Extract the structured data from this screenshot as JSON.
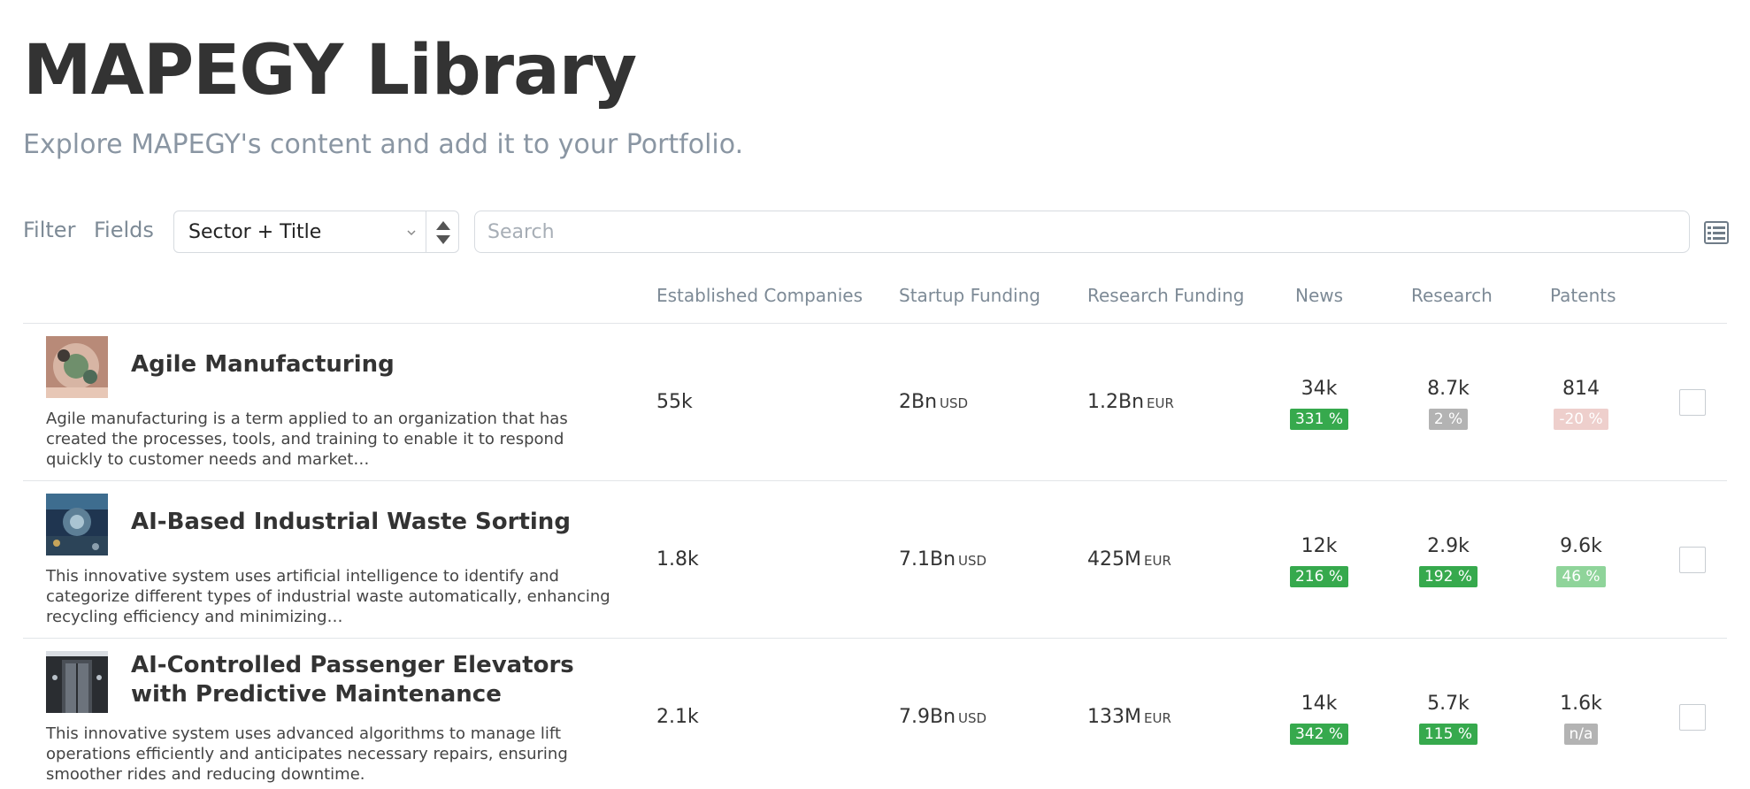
{
  "header": {
    "title": "MAPEGY Library",
    "subtitle": "Explore MAPEGY's content and add it to your Portfolio."
  },
  "toolbar": {
    "filter_label": "Filter",
    "fields_label": "Fields",
    "sort_select_value": "Sector + Title",
    "search_placeholder": "Search",
    "view_toggle_icon": "table-list-icon"
  },
  "table": {
    "columns": [
      "Established Companies",
      "Startup Funding",
      "Research Funding",
      "News",
      "Research",
      "Patents"
    ],
    "rows": [
      {
        "title": "Agile Manufacturing",
        "description": "Agile manufacturing is a term applied to an organization that has created the processes, tools, and training to enable it to respond quickly to customer needs and market…",
        "established_companies": "55k",
        "startup_funding": {
          "value": "2Bn",
          "unit": "USD"
        },
        "research_funding": {
          "value": "1.2Bn",
          "unit": "EUR"
        },
        "news": {
          "value": "34k",
          "change": "331 %",
          "tone": "strong"
        },
        "research": {
          "value": "8.7k",
          "change": "2 %",
          "tone": "grey"
        },
        "patents": {
          "value": "814",
          "change": "-20 %",
          "tone": "negative"
        },
        "checked": false
      },
      {
        "title": "AI-Based Industrial Waste Sorting",
        "description": "This innovative system uses artificial intelligence to identify and categorize different types of industrial waste automatically, enhancing recycling efficiency and minimizing…",
        "established_companies": "1.8k",
        "startup_funding": {
          "value": "7.1Bn",
          "unit": "USD"
        },
        "research_funding": {
          "value": "425M",
          "unit": "EUR"
        },
        "news": {
          "value": "12k",
          "change": "216 %",
          "tone": "strong"
        },
        "research": {
          "value": "2.9k",
          "change": "192 %",
          "tone": "strong"
        },
        "patents": {
          "value": "9.6k",
          "change": "46 %",
          "tone": "light"
        },
        "checked": false
      },
      {
        "title": "AI-Controlled Passenger Elevators with Predictive Maintenance",
        "description": "This innovative system uses advanced algorithms to manage lift operations efficiently and anticipates necessary repairs, ensuring smoother rides and reducing downtime.",
        "established_companies": "2.1k",
        "startup_funding": {
          "value": "7.9Bn",
          "unit": "USD"
        },
        "research_funding": {
          "value": "133M",
          "unit": "EUR"
        },
        "news": {
          "value": "14k",
          "change": "342 %",
          "tone": "strong"
        },
        "research": {
          "value": "5.7k",
          "change": "115 %",
          "tone": "strong"
        },
        "patents": {
          "value": "1.6k",
          "change": "n/a",
          "tone": "grey"
        },
        "checked": false
      }
    ]
  },
  "colors": {
    "badge_strong": "#36a94d",
    "badge_light": "#8fd49a",
    "badge_grey": "#b3b3b3",
    "badge_negative": "#eecfcc"
  }
}
